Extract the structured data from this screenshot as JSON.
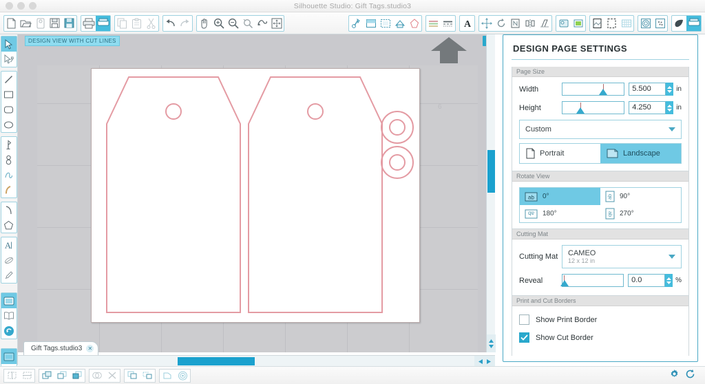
{
  "window": {
    "title": "Silhouette Studio: Gift Tags.studio3",
    "traffic_lights": [
      "close",
      "minimize",
      "maximize"
    ]
  },
  "toolbar": {
    "groups": [
      {
        "name": "file",
        "buttons": [
          {
            "name": "new-document",
            "icon": "page-icon",
            "active": false
          },
          {
            "name": "open-document",
            "icon": "folder-open-icon",
            "active": false
          },
          {
            "name": "save-library",
            "icon": "library-icon",
            "active": false
          },
          {
            "name": "save",
            "icon": "floppy-icon",
            "active": false
          },
          {
            "name": "save-as",
            "icon": "floppy-blue-icon",
            "active": false
          }
        ]
      },
      {
        "name": "output",
        "buttons": [
          {
            "name": "print",
            "icon": "printer-icon",
            "active": false
          },
          {
            "name": "send-to-silhouette",
            "icon": "cut-machine-icon",
            "active": true
          }
        ]
      },
      {
        "name": "clipboard",
        "buttons": [
          {
            "name": "copy",
            "icon": "copy-icon",
            "active": false
          },
          {
            "name": "paste",
            "icon": "paste-icon",
            "active": false
          },
          {
            "name": "cut",
            "icon": "scissors-icon",
            "active": false
          }
        ]
      },
      {
        "name": "history",
        "buttons": [
          {
            "name": "undo",
            "icon": "undo-arrow-icon",
            "active": false
          },
          {
            "name": "redo",
            "icon": "redo-arrow-icon",
            "active": false
          }
        ]
      },
      {
        "name": "view",
        "buttons": [
          {
            "name": "pan",
            "icon": "hand-icon",
            "active": false
          },
          {
            "name": "zoom-in",
            "icon": "zoom-in-icon",
            "active": false
          },
          {
            "name": "zoom-out",
            "icon": "zoom-out-icon",
            "active": false
          },
          {
            "name": "zoom-selection",
            "icon": "zoom-selection-icon",
            "active": false
          },
          {
            "name": "zoom-erase",
            "icon": "zoom-region-icon",
            "active": false
          },
          {
            "name": "fit-to-window",
            "icon": "fit-window-icon",
            "active": false
          }
        ]
      },
      {
        "name": "panels-left",
        "buttons": [
          {
            "name": "quick-access-cut",
            "icon": "cut-style-icon",
            "active": false
          },
          {
            "name": "page-setup-panel",
            "icon": "page-setup-icon",
            "active": false
          },
          {
            "name": "registration-marks-panel",
            "icon": "reg-marks-icon",
            "active": false
          },
          {
            "name": "print-cut-panel",
            "icon": "print-cut-icon",
            "active": false
          },
          {
            "name": "cut-settings-panel",
            "icon": "cut-settings-icon",
            "active": false
          }
        ]
      },
      {
        "name": "line-style",
        "buttons": [
          {
            "name": "line-color-panel",
            "icon": "line-color-icon",
            "active": false
          },
          {
            "name": "line-style-panel",
            "icon": "line-style-icon",
            "active": false
          }
        ]
      },
      {
        "name": "text",
        "buttons": [
          {
            "name": "text-style-panel",
            "icon": "text-A-icon",
            "active": false
          }
        ]
      },
      {
        "name": "transform",
        "buttons": [
          {
            "name": "move-panel",
            "icon": "move-arrows-icon",
            "active": false
          },
          {
            "name": "rotate-panel",
            "icon": "rotate-icon",
            "active": false
          },
          {
            "name": "scale-panel",
            "icon": "scale-icon",
            "active": false
          },
          {
            "name": "mirror-panel",
            "icon": "mirror-icon",
            "active": false
          },
          {
            "name": "shear-panel",
            "icon": "shear-icon",
            "active": false
          }
        ]
      },
      {
        "name": "fill",
        "buttons": [
          {
            "name": "fill-color-panel",
            "icon": "fill-color-icon",
            "active": false
          },
          {
            "name": "gradient-fill-panel",
            "icon": "gradient-fill-icon",
            "active": false
          }
        ]
      },
      {
        "name": "page-tools",
        "buttons": [
          {
            "name": "page-panel",
            "icon": "page-tool-icon",
            "active": false
          },
          {
            "name": "trace-panel",
            "icon": "trace-icon",
            "active": false
          },
          {
            "name": "grid-panel",
            "icon": "grid-icon",
            "active": false
          }
        ]
      },
      {
        "name": "effects",
        "buttons": [
          {
            "name": "offset-panel",
            "icon": "offset-spiral-icon",
            "active": false
          },
          {
            "name": "sketch-panel",
            "icon": "sketch-dots-icon",
            "active": false
          }
        ]
      },
      {
        "name": "library",
        "buttons": [
          {
            "name": "store-panel",
            "icon": "leaf-icon",
            "active": false
          },
          {
            "name": "send-panel",
            "icon": "send-machine-icon",
            "active": true
          }
        ]
      }
    ]
  },
  "tool_rail": {
    "groups": [
      {
        "name": "selection",
        "tools": [
          {
            "name": "select-tool",
            "icon": "arrow-cursor-icon",
            "active": true
          },
          {
            "name": "edit-points-tool",
            "icon": "edit-points-icon",
            "active": false
          }
        ]
      },
      {
        "name": "shapes",
        "tools": [
          {
            "name": "line-tool",
            "icon": "line-icon",
            "active": false
          },
          {
            "name": "rectangle-tool",
            "icon": "rectangle-icon",
            "active": false
          },
          {
            "name": "rounded-rectangle-tool",
            "icon": "rounded-rect-icon",
            "active": false
          },
          {
            "name": "ellipse-tool",
            "icon": "ellipse-icon",
            "active": false
          }
        ]
      },
      {
        "name": "draw",
        "tools": [
          {
            "name": "polygon-tool",
            "icon": "polygon-pin-icon",
            "active": false
          },
          {
            "name": "curve-tool",
            "icon": "curve-icon",
            "active": false
          },
          {
            "name": "freehand-tool",
            "icon": "freehand-icon",
            "active": false
          },
          {
            "name": "smooth-freehand-tool",
            "icon": "smooth-freehand-icon",
            "active": false
          }
        ]
      },
      {
        "name": "arcs",
        "tools": [
          {
            "name": "arc-tool",
            "icon": "arc-icon",
            "active": false
          },
          {
            "name": "regular-polygon-tool",
            "icon": "pentagon-icon",
            "active": false
          }
        ]
      },
      {
        "name": "text-tools",
        "tools": [
          {
            "name": "text-tool",
            "icon": "text-A-icon",
            "active": false
          },
          {
            "name": "knife-tool",
            "icon": "knife-icon",
            "active": false
          },
          {
            "name": "eyedropper-tool",
            "icon": "eyedropper-icon",
            "active": false
          }
        ]
      },
      {
        "name": "library-tools",
        "tools": [
          {
            "name": "my-library",
            "icon": "library-panel-icon",
            "active": true
          },
          {
            "name": "store",
            "icon": "book-icon",
            "active": false
          },
          {
            "name": "sync",
            "icon": "sync-arrow-icon",
            "active": false
          }
        ]
      },
      {
        "name": "send-tools",
        "tools": [
          {
            "name": "design-page",
            "icon": "design-page-icon",
            "active": true
          },
          {
            "name": "send-page",
            "icon": "play-triangle-icon",
            "active": false
          }
        ]
      }
    ]
  },
  "canvas": {
    "view_badge": "DESIGN VIEW WITH CUT LINES",
    "collapse_button": "»",
    "ruler_label": "6",
    "feed_arrow": "mat-feed-arrow-icon",
    "cut_line_color": "#e8a0a6",
    "page_background": "#ffffff",
    "mat_background": "#cccccf",
    "shapes": [
      {
        "name": "gift-tag-left",
        "type": "tag-outline"
      },
      {
        "name": "gift-tag-left-hole",
        "type": "circle"
      },
      {
        "name": "gift-tag-right",
        "type": "tag-outline"
      },
      {
        "name": "gift-tag-right-hole",
        "type": "circle"
      },
      {
        "name": "reinforcement-ring-top",
        "type": "donut"
      },
      {
        "name": "reinforcement-ring-bottom",
        "type": "donut"
      }
    ]
  },
  "document_tab": {
    "label": "Gift Tags.studio3",
    "close": "✕"
  },
  "panel": {
    "title": "DESIGN PAGE SETTINGS",
    "page_size": {
      "header": "Page Size",
      "width_label": "Width",
      "width_value": "5.500",
      "width_unit": "in",
      "height_label": "Height",
      "height_value": "4.250",
      "height_unit": "in",
      "preset": "Custom"
    },
    "orientation": {
      "portrait": "Portrait",
      "landscape": "Landscape",
      "selected": "Landscape"
    },
    "rotate_view": {
      "header": "Rotate View",
      "options": [
        {
          "label": "0°",
          "icon": "rotate-0-icon",
          "selected": true
        },
        {
          "label": "90°",
          "icon": "rotate-90-icon",
          "selected": false
        },
        {
          "label": "180°",
          "icon": "rotate-180-icon",
          "selected": false
        },
        {
          "label": "270°",
          "icon": "rotate-270-icon",
          "selected": false
        }
      ]
    },
    "cutting_mat": {
      "header": "Cutting Mat",
      "label": "Cutting Mat",
      "value": "CAMEO",
      "value_sub": "12 x 12 in",
      "reveal_label": "Reveal",
      "reveal_value": "0.0",
      "reveal_unit": "%"
    },
    "borders": {
      "header": "Print and Cut Borders",
      "show_print_border": "Show Print Border",
      "show_print_border_checked": false,
      "show_cut_border": "Show Cut Border",
      "show_cut_border_checked": true
    }
  },
  "statusbar": {
    "groups": [
      {
        "name": "align-group",
        "buttons": [
          {
            "name": "align-horizontal",
            "icon": "align-h-icon"
          },
          {
            "name": "align-vertical",
            "icon": "align-v-icon"
          }
        ]
      },
      {
        "name": "arrange-group",
        "buttons": [
          {
            "name": "bring-to-front",
            "icon": "bring-front-icon"
          },
          {
            "name": "send-backward",
            "icon": "send-backward-icon"
          },
          {
            "name": "send-to-back",
            "icon": "send-back-icon"
          }
        ]
      },
      {
        "name": "modify-group",
        "buttons": [
          {
            "name": "weld",
            "icon": "weld-icon"
          },
          {
            "name": "subtract",
            "icon": "subtract-x-icon"
          }
        ]
      },
      {
        "name": "group-group",
        "buttons": [
          {
            "name": "group",
            "icon": "group-icon"
          },
          {
            "name": "ungroup",
            "icon": "ungroup-icon"
          }
        ]
      },
      {
        "name": "path-group",
        "buttons": [
          {
            "name": "make-compound-path",
            "icon": "compound-path-icon"
          },
          {
            "name": "offset",
            "icon": "offset-circle-icon"
          }
        ]
      }
    ],
    "end_icons": [
      {
        "name": "preferences",
        "icon": "gear-icon"
      },
      {
        "name": "sync-status",
        "icon": "refresh-icon"
      }
    ]
  }
}
